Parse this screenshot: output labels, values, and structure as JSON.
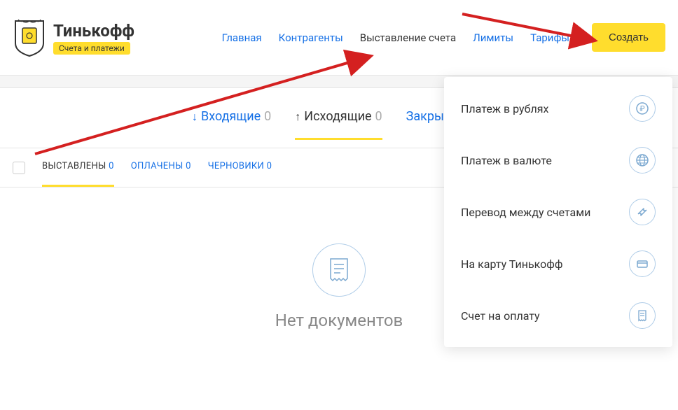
{
  "logo": {
    "title": "Тинькофф",
    "badge": "Счета и платежи"
  },
  "nav": {
    "home": "Главная",
    "contractors": "Контрагенты",
    "invoicing": "Выставление счета",
    "limits": "Лимиты",
    "tariffs": "Тарифы",
    "create": "Создать"
  },
  "tabs": {
    "incoming": "Входящие",
    "incoming_count": "0",
    "outgoing": "Исходящие",
    "outgoing_count": "0",
    "closing": "Закрывающи"
  },
  "subtabs": {
    "issued": "ВЫСТАВЛЕНЫ",
    "issued_count": "0",
    "paid": "ОПЛАЧЕНЫ",
    "paid_count": "0",
    "drafts": "ЧЕРНОВИКИ",
    "drafts_count": "0"
  },
  "empty": {
    "text": "Нет документов"
  },
  "dropdown": {
    "payment_rub": "Платеж в рублях",
    "payment_currency": "Платеж в валюте",
    "transfer": "Перевод между счетами",
    "to_card": "На карту Тинькофф",
    "invoice": "Счет на оплату"
  }
}
